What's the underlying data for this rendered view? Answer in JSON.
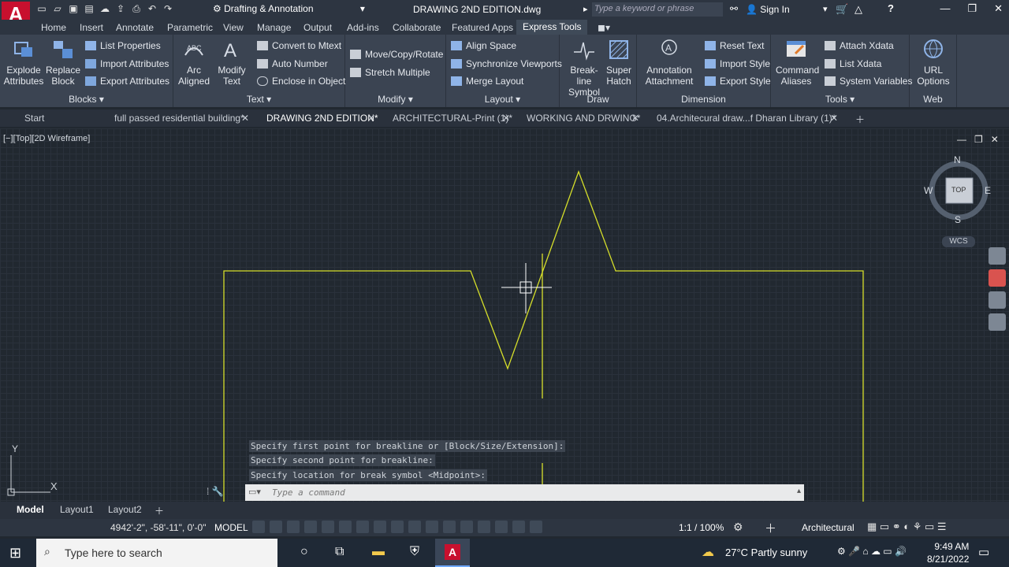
{
  "app": {
    "logo_letter": "A",
    "workspace": "Drafting & Annotation",
    "document_title": "DRAWING 2ND EDITION.dwg",
    "search_placeholder": "Type a keyword or phrase",
    "sign_in": "Sign In"
  },
  "ribbon_tabs": [
    "Home",
    "Insert",
    "Annotate",
    "Parametric",
    "View",
    "Manage",
    "Output",
    "Add-ins",
    "Collaborate",
    "Featured Apps",
    "Express Tools"
  ],
  "active_ribbon_tab": "Express Tools",
  "panels": {
    "blocks": {
      "title": "Blocks",
      "explode": "Explode Attributes",
      "replace": "Replace Block",
      "list_properties": "List Properties",
      "import_attributes": "Import Attributes",
      "export_attributes": "Export Attributes"
    },
    "text": {
      "title": "Text",
      "arc_aligned": "Arc Aligned",
      "modify_text": "Modify Text",
      "convert_mtext": "Convert to Mtext",
      "auto_number": "Auto Number",
      "enclose": "Enclose in Object"
    },
    "modify": {
      "title": "Modify",
      "move_copy_rotate": "Move/Copy/Rotate",
      "stretch_multiple": "Stretch Multiple"
    },
    "layout": {
      "title": "Layout",
      "align_space": "Align Space",
      "sync_viewports": "Synchronize Viewports",
      "merge_layout": "Merge Layout"
    },
    "draw": {
      "title": "Draw",
      "breakline": "Break-line Symbol",
      "super_hatch": "Super Hatch"
    },
    "dimension": {
      "title": "Dimension",
      "annotation_attachment": "Annotation Attachment",
      "reset_text": "Reset Text",
      "import_style": "Import Style",
      "export_style": "Export Style"
    },
    "tools": {
      "title": "Tools",
      "command_aliases": "Command Aliases",
      "attach_xdata": "Attach Xdata",
      "list_xdata": "List Xdata",
      "system_variables": "System Variables"
    },
    "web": {
      "title": "Web",
      "url_options": "URL Options"
    }
  },
  "file_tabs": [
    "Start",
    "full passed residential building*",
    "DRAWING 2ND EDITION*",
    "ARCHITECTURAL-Print (1)*",
    "WORKING AND DRWING*",
    "04.Architecural draw...f Dharan Library (1)*"
  ],
  "active_file_tab": "DRAWING 2ND EDITION*",
  "viewport_label": "[−][Top][2D Wireframe]",
  "viewcube": {
    "n": "N",
    "s": "S",
    "e": "E",
    "w": "W",
    "face": "TOP",
    "wcs": "WCS"
  },
  "command_history": [
    "Specify first point for breakline or [Block/Size/Extension]:",
    "Specify second point for breakline:",
    "Specify location for break symbol <Midpoint>:"
  ],
  "command_placeholder": "Type a command",
  "layout_tabs": [
    "Model",
    "Layout1",
    "Layout2"
  ],
  "active_layout_tab": "Model",
  "status": {
    "coords": "4942'-2\", -58'-11\", 0'-0\"",
    "mode": "MODEL",
    "scale": "1:1 / 100%",
    "units": "Architectural"
  },
  "taskbar": {
    "search": "Type here to search",
    "weather": "27°C  Partly sunny",
    "time": "9:49 AM",
    "date": "8/21/2022"
  },
  "colors": {
    "line": "#d6df2a",
    "canvas": "#212830",
    "accent": "#c8102e"
  }
}
